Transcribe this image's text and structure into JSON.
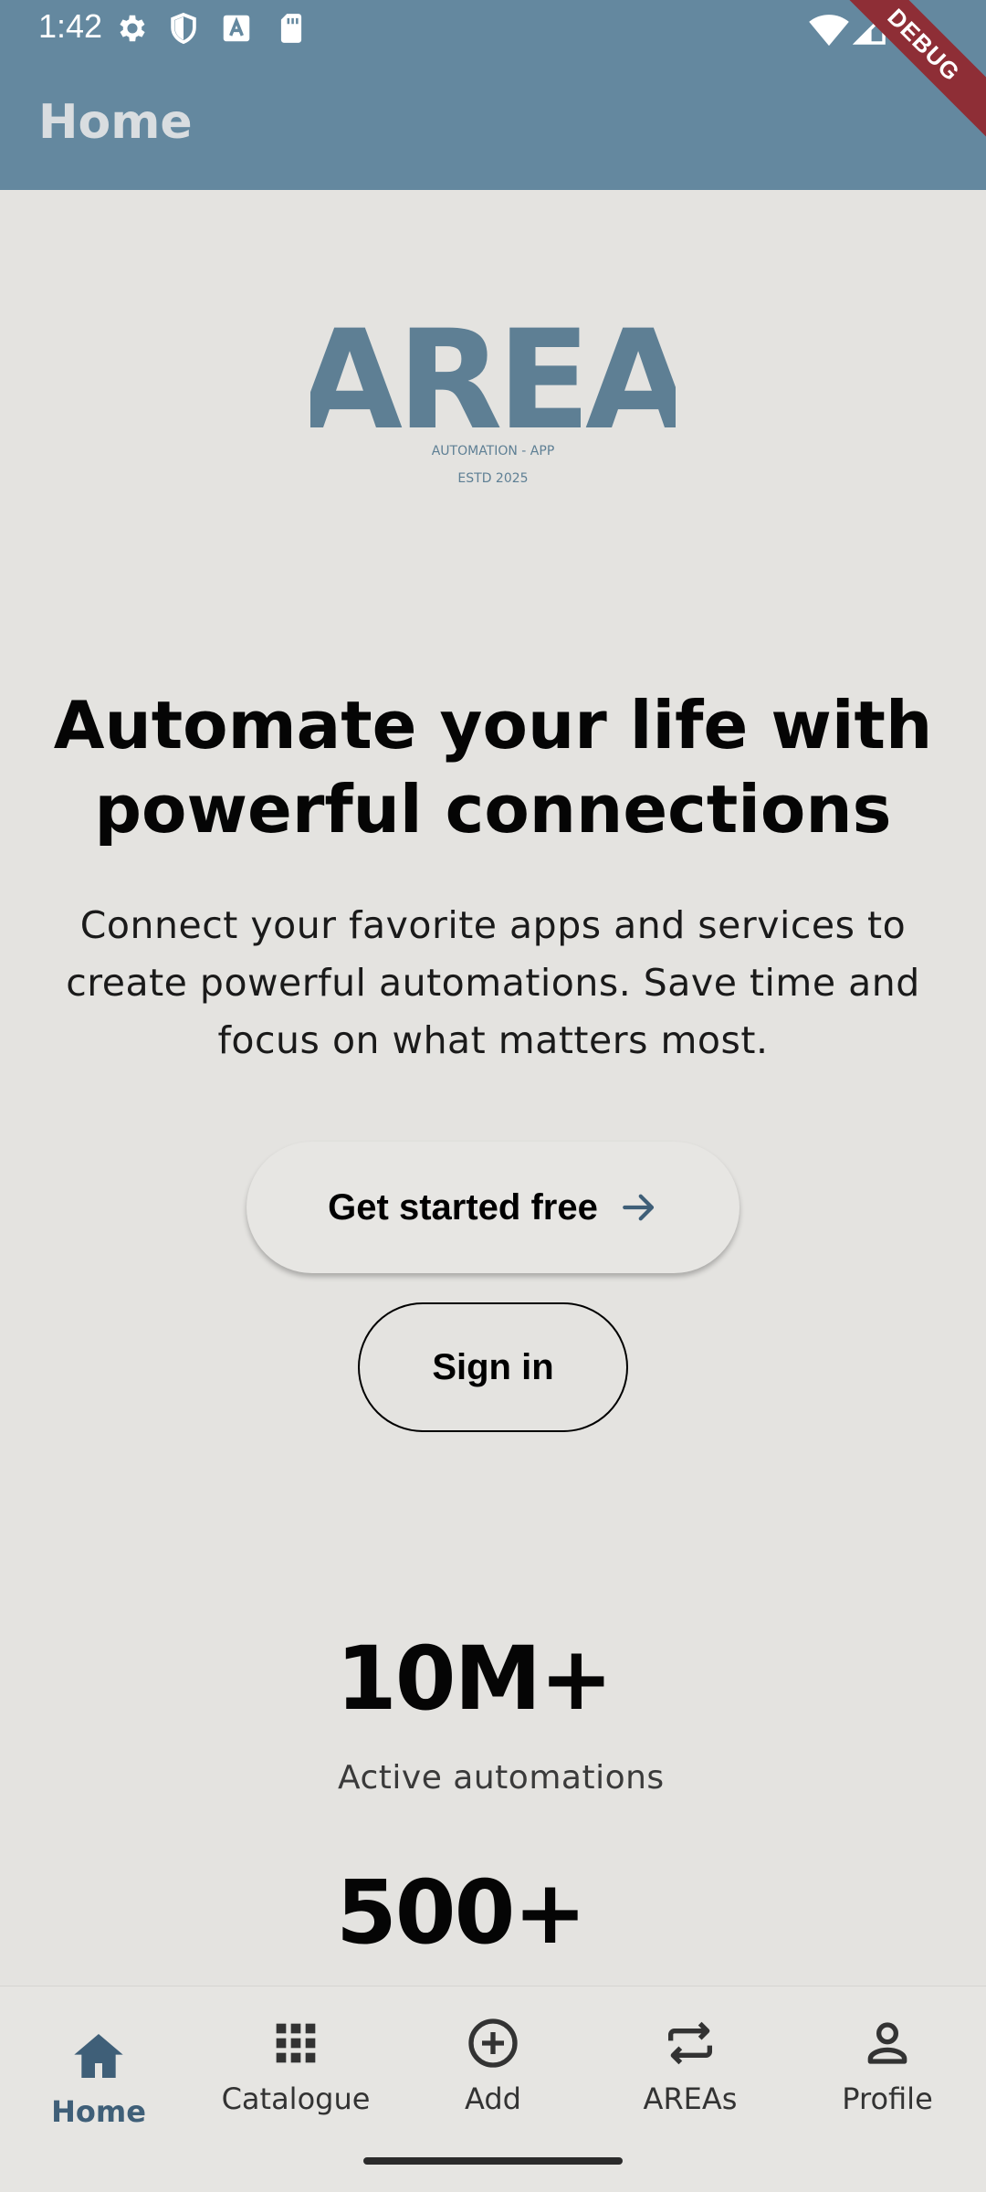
{
  "status_bar": {
    "time": "1:42",
    "icons": [
      "gear-icon",
      "shield-icon",
      "font-a-icon",
      "sd-card-icon",
      "wifi-icon",
      "signal-icon",
      "battery-icon"
    ]
  },
  "app_bar": {
    "title": "Home",
    "debug_label": "DEBUG"
  },
  "logo": {
    "wordmark": "AREA",
    "tagline": "AUTOMATION - APP",
    "established": "ESTD 2025"
  },
  "hero": {
    "headline_line1": "Automate your life with",
    "headline_line2": "powerful connections",
    "sub_line1": "Connect your favorite apps and services to",
    "sub_line2": "create powerful automations. Save time and",
    "sub_line3": "focus on what matters most."
  },
  "actions": {
    "primary_label": "Get started free",
    "secondary_label": "Sign in"
  },
  "stats": [
    {
      "value": "10M+",
      "label": "Active automations"
    },
    {
      "value": "500+",
      "label": ""
    }
  ],
  "bottom_nav": {
    "items": [
      {
        "label": "Home",
        "icon": "home-icon",
        "active": true
      },
      {
        "label": "Catalogue",
        "icon": "grid-icon",
        "active": false
      },
      {
        "label": "Add",
        "icon": "add-circle-icon",
        "active": false
      },
      {
        "label": "AREAs",
        "icon": "repeat-icon",
        "active": false
      },
      {
        "label": "Profile",
        "icon": "person-icon",
        "active": false
      }
    ]
  },
  "colors": {
    "app_bar": "#64889f",
    "logo": "#5e7f94",
    "background": "#e4e3e0",
    "nav_active": "#3f5f78",
    "debug_ribbon": "#8e2e36"
  }
}
